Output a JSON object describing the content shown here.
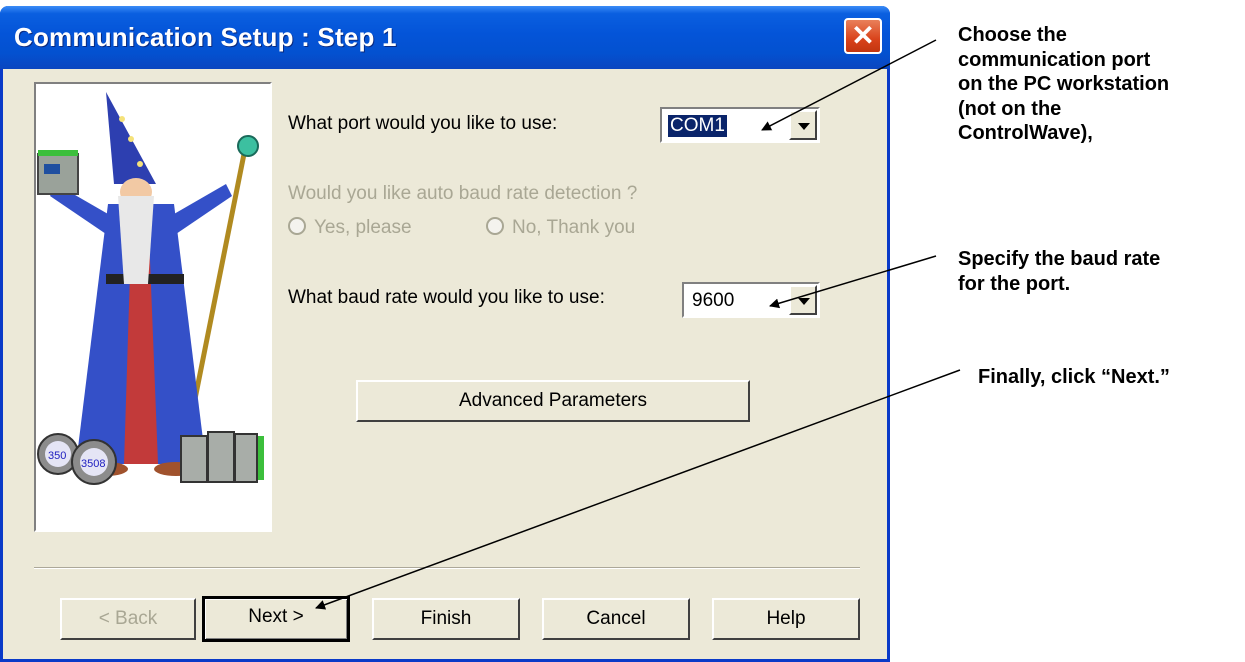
{
  "window": {
    "title": "Communication Setup : Step 1",
    "close_glyph": "✕"
  },
  "port": {
    "question": "What port would you like to use:",
    "value": "COM1"
  },
  "auto_baud": {
    "question": "Would you like auto baud rate detection ?",
    "yes_label": "Yes, please",
    "no_label": "No, Thank you"
  },
  "baud": {
    "question": "What baud rate would you like to use:",
    "value": "9600"
  },
  "advanced_button": "Advanced Parameters",
  "picture": {
    "device_labels": [
      "350",
      "3508"
    ]
  },
  "buttons": {
    "back": "< Back",
    "next": "Next >",
    "finish": "Finish",
    "cancel": "Cancel",
    "help": "Help"
  },
  "annotations": {
    "port_note": [
      "Choose the",
      "communication port",
      "on the PC workstation",
      "(not on the",
      "ControlWave),"
    ],
    "baud_note": [
      "Specify the baud rate",
      "for the port."
    ],
    "next_note": "Finally, click “Next.”"
  },
  "colors": {
    "titlebar": "#0454d8",
    "dialog_face": "#ece9d8",
    "disabled_text": "#a9a794",
    "selection": "#0a246a"
  }
}
